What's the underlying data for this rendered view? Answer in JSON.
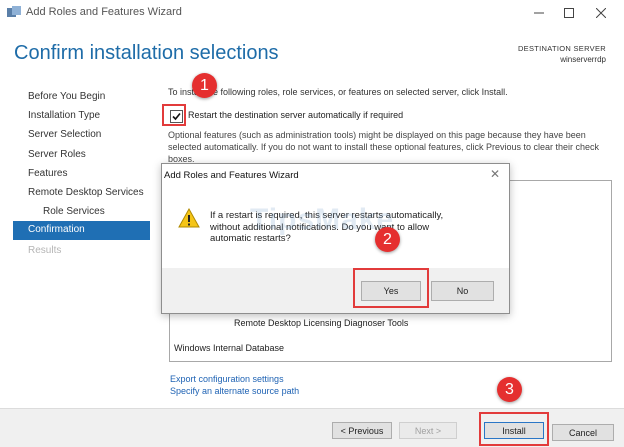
{
  "window": {
    "title": "Add Roles and Features Wizard"
  },
  "header": {
    "title": "Confirm installation selections",
    "destination_label": "DESTINATION SERVER",
    "destination_server": "winserverrdp"
  },
  "nav": {
    "items": [
      {
        "label": "Before You Begin"
      },
      {
        "label": "Installation Type"
      },
      {
        "label": "Server Selection"
      },
      {
        "label": "Server Roles"
      },
      {
        "label": "Features"
      },
      {
        "label": "Remote Desktop Services"
      },
      {
        "label": "Role Services"
      },
      {
        "label": "Confirmation"
      },
      {
        "label": "Results"
      }
    ]
  },
  "content": {
    "intro": "To install the following roles, role services, or features on selected server, click Install.",
    "restart_checkbox_label": "Restart the destination server automatically if required",
    "restart_checked": true,
    "optional_text": "Optional features (such as administration tools) might be displayed on this page because they have been selected automatically. If you do not want to install these optional features, click Previous to clear their check boxes.",
    "list_items": [
      "Remote Desktop Licensing Diagnoser Tools",
      "Windows Internal Database"
    ],
    "export_link": "Export configuration settings",
    "alternate_source_link": "Specify an alternate source path"
  },
  "footer": {
    "previous_label": "< Previous",
    "next_label": "Next >",
    "install_label": "Install",
    "cancel_label": "Cancel"
  },
  "dialog": {
    "title": "Add Roles and Features Wizard",
    "close_glyph": "✕",
    "message": "If a restart is required, this server restarts automatically, without additional notifications. Do you want to allow automatic restarts?",
    "yes_label": "Yes",
    "no_label": "No"
  },
  "watermark": "TipsMake",
  "annotations": {
    "step1": "1",
    "step2": "2",
    "step3": "3",
    "color": "#e23b3b"
  },
  "colors": {
    "accent": "#1f6fb4",
    "title": "#1e6ca8",
    "link": "#1f63b4"
  }
}
